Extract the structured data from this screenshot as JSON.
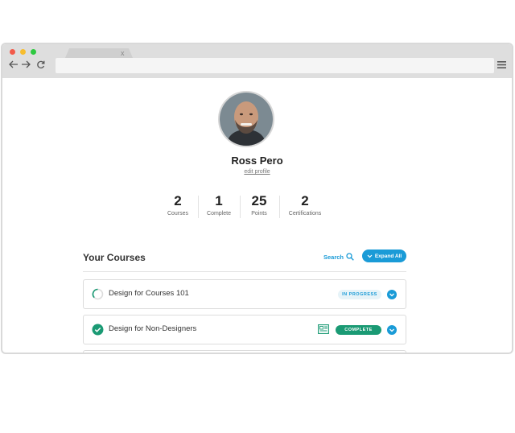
{
  "browser": {
    "tab_close": "x",
    "colors": {
      "red": "#f25a4a",
      "yellow": "#f7bd2e",
      "green": "#2ec940"
    }
  },
  "profile": {
    "name": "Ross Pero",
    "edit_label": "edit profile",
    "avatar_icon": "user-photo"
  },
  "stats": [
    {
      "value": "2",
      "label": "Courses"
    },
    {
      "value": "1",
      "label": "Complete"
    },
    {
      "value": "25",
      "label": "Points"
    },
    {
      "value": "2",
      "label": "Certifications"
    }
  ],
  "courses_section": {
    "title": "Your Courses",
    "search_label": "Search",
    "expand_label": "Expand All",
    "items": [
      {
        "title": "Design for Courses 101",
        "status": "IN PROGRESS"
      },
      {
        "title": "Design for Non-Designers",
        "status": "COMPLETE"
      }
    ]
  },
  "colors": {
    "accent": "#1a9bd7",
    "complete": "#1a9a74"
  }
}
